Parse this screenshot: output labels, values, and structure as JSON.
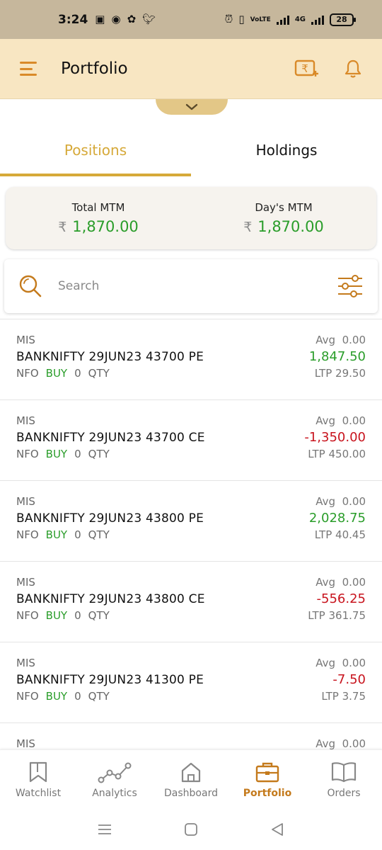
{
  "status_bar": {
    "time": "3:24",
    "network": "4G",
    "volte": "VoLTE",
    "battery": "28"
  },
  "header": {
    "title": "Portfolio"
  },
  "tabs": [
    {
      "label": "Positions",
      "active": true
    },
    {
      "label": "Holdings",
      "active": false
    }
  ],
  "mtm": {
    "total_label": "Total MTM",
    "total_currency": "₹",
    "total_value": "1,870.00",
    "day_label": "Day's MTM",
    "day_currency": "₹",
    "day_value": "1,870.00"
  },
  "search": {
    "placeholder": "Search"
  },
  "positions": [
    {
      "product": "MIS",
      "symbol": "BANKNIFTY 29JUN23 43700 PE",
      "exchange": "NFO",
      "side": "BUY",
      "qty": "0",
      "qty_label": "QTY",
      "avg_label": "Avg",
      "avg": "0.00",
      "pnl": "1,847.50",
      "pnl_sign": "positive",
      "ltp_label": "LTP",
      "ltp": "29.50"
    },
    {
      "product": "MIS",
      "symbol": "BANKNIFTY 29JUN23 43700 CE",
      "exchange": "NFO",
      "side": "BUY",
      "qty": "0",
      "qty_label": "QTY",
      "avg_label": "Avg",
      "avg": "0.00",
      "pnl": "-1,350.00",
      "pnl_sign": "negative",
      "ltp_label": "LTP",
      "ltp": "450.00"
    },
    {
      "product": "MIS",
      "symbol": "BANKNIFTY 29JUN23 43800 PE",
      "exchange": "NFO",
      "side": "BUY",
      "qty": "0",
      "qty_label": "QTY",
      "avg_label": "Avg",
      "avg": "0.00",
      "pnl": "2,028.75",
      "pnl_sign": "positive",
      "ltp_label": "LTP",
      "ltp": "40.45"
    },
    {
      "product": "MIS",
      "symbol": "BANKNIFTY 29JUN23 43800 CE",
      "exchange": "NFO",
      "side": "BUY",
      "qty": "0",
      "qty_label": "QTY",
      "avg_label": "Avg",
      "avg": "0.00",
      "pnl": "-556.25",
      "pnl_sign": "negative",
      "ltp_label": "LTP",
      "ltp": "361.75"
    },
    {
      "product": "MIS",
      "symbol": "BANKNIFTY 29JUN23 41300 PE",
      "exchange": "NFO",
      "side": "BUY",
      "qty": "0",
      "qty_label": "QTY",
      "avg_label": "Avg",
      "avg": "0.00",
      "pnl": "-7.50",
      "pnl_sign": "negative",
      "ltp_label": "LTP",
      "ltp": "3.75"
    },
    {
      "product": "MIS",
      "symbol": "",
      "exchange": "",
      "side": "",
      "qty": "",
      "qty_label": "",
      "avg_label": "Avg",
      "avg": "0.00",
      "pnl": "",
      "pnl_sign": "positive",
      "ltp_label": "",
      "ltp": ""
    }
  ],
  "bottom_nav": [
    {
      "label": "Watchlist",
      "icon": "bookmark-icon",
      "active": false
    },
    {
      "label": "Analytics",
      "icon": "analytics-icon",
      "active": false
    },
    {
      "label": "Dashboard",
      "icon": "home-icon",
      "active": false
    },
    {
      "label": "Portfolio",
      "icon": "briefcase-icon",
      "active": true
    },
    {
      "label": "Orders",
      "icon": "book-icon",
      "active": false
    }
  ],
  "colors": {
    "accent": "#d6a939",
    "header_bg": "#f8e6c2",
    "profit": "#2a9d2a",
    "loss": "#c8141e",
    "active_nav": "#c47a1c"
  }
}
